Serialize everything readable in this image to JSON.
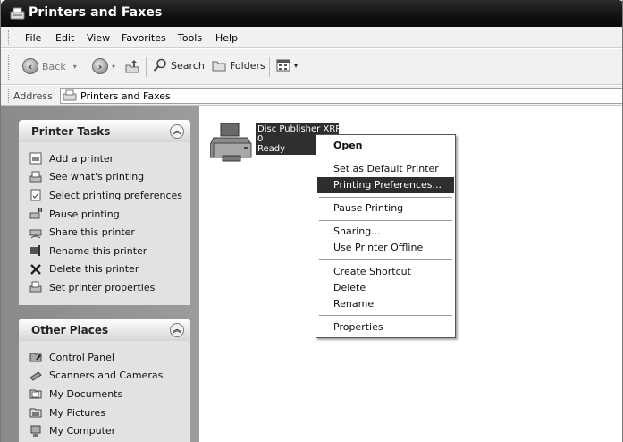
{
  "window": {
    "title": "Printers and Faxes"
  },
  "menubar": {
    "items": [
      "File",
      "Edit",
      "View",
      "Favorites",
      "Tools",
      "Help"
    ]
  },
  "toolbar": {
    "back": "Back",
    "search": "Search",
    "folders": "Folders"
  },
  "address": {
    "label": "Address",
    "value": "Printers and Faxes"
  },
  "printer_tasks": {
    "title": "Printer Tasks",
    "items": [
      {
        "label": "Add a printer",
        "icon": "add-printer-icon"
      },
      {
        "label": "See what's printing",
        "icon": "print-queue-icon"
      },
      {
        "label": "Select printing preferences",
        "icon": "preferences-icon"
      },
      {
        "label": "Pause printing",
        "icon": "pause-printer-icon"
      },
      {
        "label": "Share this printer",
        "icon": "share-printer-icon"
      },
      {
        "label": "Rename this printer",
        "icon": "rename-icon"
      },
      {
        "label": "Delete this printer",
        "icon": "delete-x-icon"
      },
      {
        "label": "Set printer properties",
        "icon": "printer-properties-icon"
      }
    ]
  },
  "other_places": {
    "title": "Other Places",
    "items": [
      {
        "label": "Control Panel",
        "icon": "control-panel-icon"
      },
      {
        "label": "Scanners and Cameras",
        "icon": "scanner-icon"
      },
      {
        "label": "My Documents",
        "icon": "folder-icon"
      },
      {
        "label": "My Pictures",
        "icon": "pictures-folder-icon"
      },
      {
        "label": "My Computer",
        "icon": "computer-icon"
      }
    ]
  },
  "printer": {
    "name": "Disc Publisher XRP",
    "jobs": "0",
    "status": "Ready"
  },
  "context_menu": {
    "open": "Open",
    "set_default": "Set as Default Printer",
    "printing_prefs": "Printing Preferences...",
    "pause": "Pause Printing",
    "sharing": "Sharing...",
    "offline": "Use Printer Offline",
    "shortcut": "Create Shortcut",
    "delete": "Delete",
    "rename": "Rename",
    "properties": "Properties"
  }
}
